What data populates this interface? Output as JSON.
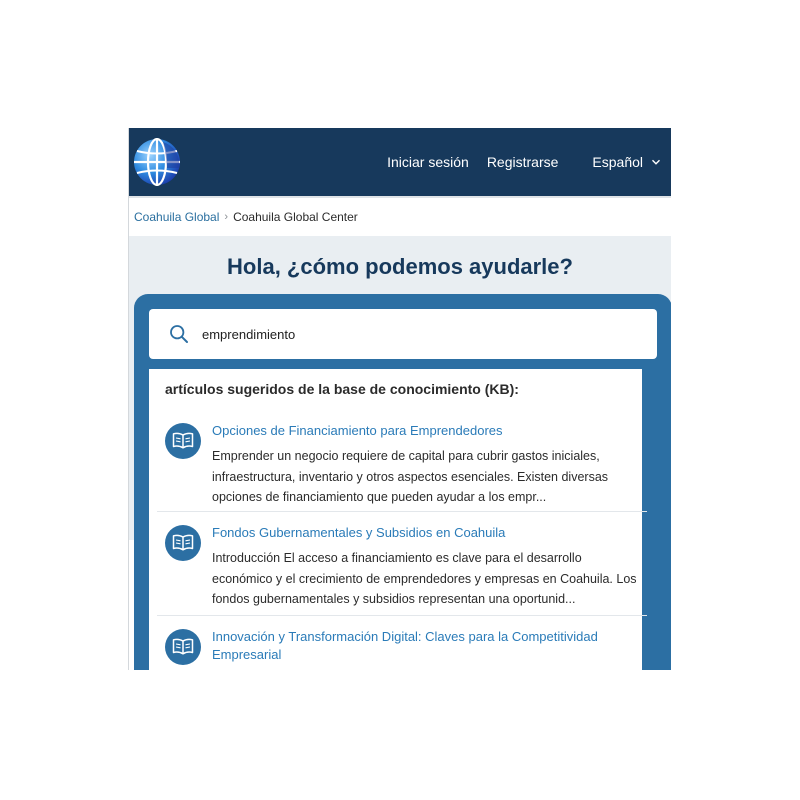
{
  "header": {
    "logo_icon": "globe-logo-icon",
    "login_label": "Iniciar sesión",
    "register_label": "Registrarse",
    "language_label": "Español",
    "background_color": "#17395c"
  },
  "breadcrumb": {
    "items": [
      "Coahuila Global",
      "Coahuila Global Center"
    ]
  },
  "hero": {
    "title": "Hola, ¿cómo podemos ayudarle?"
  },
  "search": {
    "value": "emprendimiento",
    "icon": "search-icon"
  },
  "results": {
    "heading": "artículos sugeridos de la base de conocimiento (KB):",
    "articles": [
      {
        "title": "Opciones de Financiamiento para Emprendedores",
        "excerpt": "Emprender un negocio requiere de capital para cubrir gastos iniciales, infraestructura, inventario y otros aspectos esenciales. Existen diversas opciones de financiamiento que pueden ayudar a los empr...",
        "icon": "book-icon"
      },
      {
        "title": "Fondos Gubernamentales y Subsidios en Coahuila",
        "excerpt": "Introducción El acceso a financiamiento es clave para el desarrollo económico y el crecimiento de emprendedores y empresas en Coahuila. Los fondos gubernamentales y subsidios representan una oportunid...",
        "icon": "book-icon"
      },
      {
        "title": "Innovación y Transformación Digital: Claves para la Competitividad Empresarial",
        "excerpt": "",
        "icon": "book-icon"
      }
    ]
  },
  "colors": {
    "accent": "#2c6fa3",
    "link": "#2a7bb8",
    "hero_background": "#e9eef2"
  }
}
